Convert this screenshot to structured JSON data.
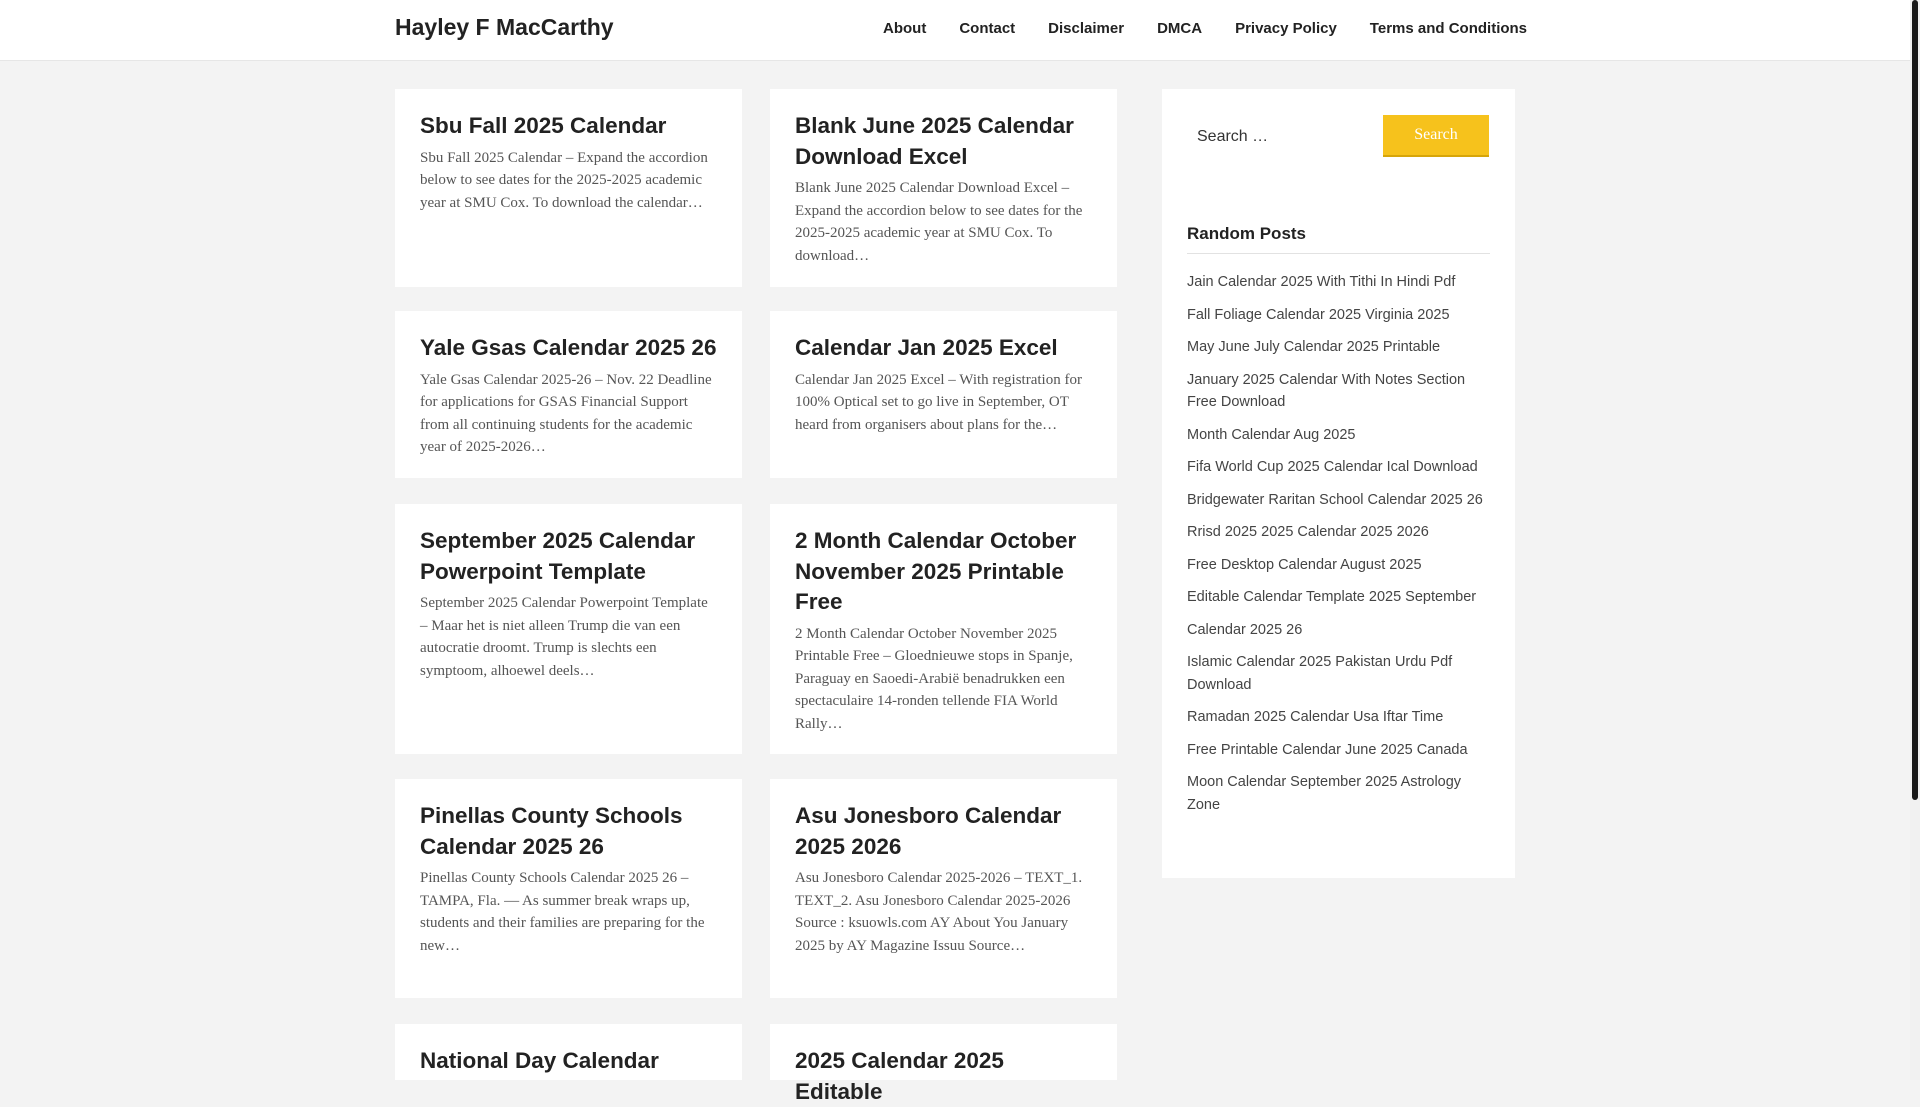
{
  "header": {
    "site_title": "Hayley F MacCarthy",
    "nav": [
      "About",
      "Contact",
      "Disclaimer",
      "DMCA",
      "Privacy Policy",
      "Terms and Conditions"
    ]
  },
  "posts": [
    {
      "title": "Sbu Fall 2025 Calendar",
      "excerpt": "Sbu Fall 2025 Calendar – Expand the accordion below to see dates for the 2025-2025 academic year at SMU Cox. To download the calendar…"
    },
    {
      "title": "Blank June 2025 Calendar Download Excel",
      "excerpt": "Blank June 2025 Calendar Download Excel – Expand the accordion below to see dates for the 2025-2025 academic year at SMU Cox. To download…"
    },
    {
      "title": "Yale Gsas Calendar 2025 26",
      "excerpt": "Yale Gsas Calendar 2025-26 – Nov. 22 Deadline for applications for GSAS Financial Support from all continuing students for the academic year of 2025-2026…"
    },
    {
      "title": "Calendar Jan 2025 Excel",
      "excerpt": "Calendar Jan 2025 Excel – With registration for 100% Optical set to go live in September, OT heard from organisers about plans for the…"
    },
    {
      "title": "September 2025 Calendar Powerpoint Template",
      "excerpt": "September 2025 Calendar Powerpoint Template – Maar het is niet alleen Trump die van een autocratie droomt. Trump is slechts een symptoom, alhoewel deels…"
    },
    {
      "title": "2 Month Calendar October November 2025 Printable Free",
      "excerpt": "2 Month Calendar October November 2025 Printable Free – Gloednieuwe stops in Spanje, Paraguay en Saoedi-Arabië benadrukken een spectaculaire 14-ronden tellende FIA World Rally…"
    },
    {
      "title": "Pinellas County Schools Calendar 2025 26",
      "excerpt": "Pinellas County Schools Calendar 2025 26 – TAMPA, Fla. — As summer break wraps up, students and their families are preparing for the new…"
    },
    {
      "title": "Asu Jonesboro Calendar 2025 2026",
      "excerpt": "Asu Jonesboro Calendar 2025-2026 – TEXT_1. TEXT_2. Asu Jonesboro Calendar 2025-2026 Source : ksuowls.com AY About You January 2025 by AY Magazine Issuu Source…"
    },
    {
      "title": "National Day Calendar",
      "excerpt": ""
    },
    {
      "title": "2025 Calendar 2025 Editable",
      "excerpt": ""
    }
  ],
  "sidebar": {
    "search_placeholder": "Search …",
    "search_button": "Search",
    "random_title": "Random Posts",
    "random_posts": [
      "Jain Calendar 2025 With Tithi In Hindi Pdf",
      "Fall Foliage Calendar 2025 Virginia 2025",
      "May June July Calendar 2025 Printable",
      "January 2025 Calendar With Notes Section Free Download",
      "Month Calendar Aug 2025",
      "Fifa World Cup 2025 Calendar Ical Download",
      "Bridgewater Raritan School Calendar 2025 26",
      "Rrisd 2025 2025 Calendar 2025 2026",
      "Free Desktop Calendar August 2025",
      "Editable Calendar Template 2025 September",
      "Calendar 2025 26",
      "Islamic Calendar 2025 Pakistan Urdu Pdf Download",
      "Ramadan 2025 Calendar Usa Iftar Time",
      "Free Printable Calendar June 2025 Canada",
      "Moon Calendar September 2025 Astrology Zone"
    ]
  }
}
